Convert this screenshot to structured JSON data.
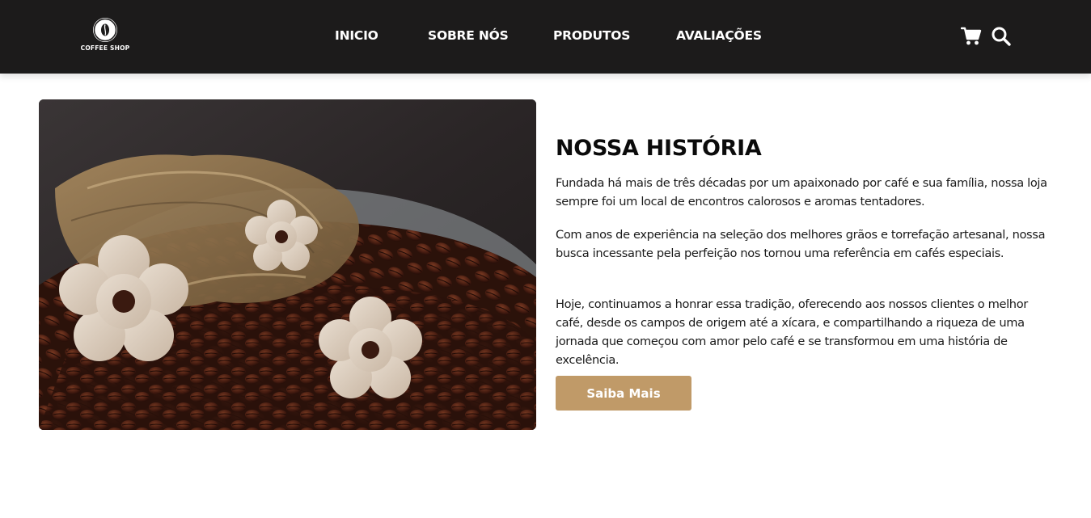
{
  "header": {
    "logo_text": "COFFEE SHOP",
    "nav": {
      "inicio": "INICIO",
      "sobre": "SOBRE NÓS",
      "produtos": "PRODUTOS",
      "avaliacoes": "AVALIAÇÕES"
    },
    "icons": [
      "cart-icon",
      "search-icon"
    ]
  },
  "about": {
    "title": "NOSSA HISTÓRIA",
    "paragraph_1": "Fundada há mais de três décadas por um apaixonado por café e sua família, nossa loja sempre foi um local de encontros calorosos e aromas tentadores.",
    "paragraph_2": "Com anos de experiência na seleção dos melhores grãos e torrefação artesanal, nossa busca incessante pela perfeição nos tornou uma referência em cafés especiais.",
    "paragraph_3": "Hoje, continuamos a honrar essa tradição, oferecendo aos nossos clientes o melhor café, desde os campos de origem até a xícara, e compartilhando a riqueza de uma jornada que começou com amor pelo café e se transformou em uma história de excelência.",
    "button_label": "Saiba Mais"
  },
  "colors": {
    "header_bg": "#1c1b1b",
    "accent": "#c09a68",
    "text": "#1a1a1a"
  }
}
